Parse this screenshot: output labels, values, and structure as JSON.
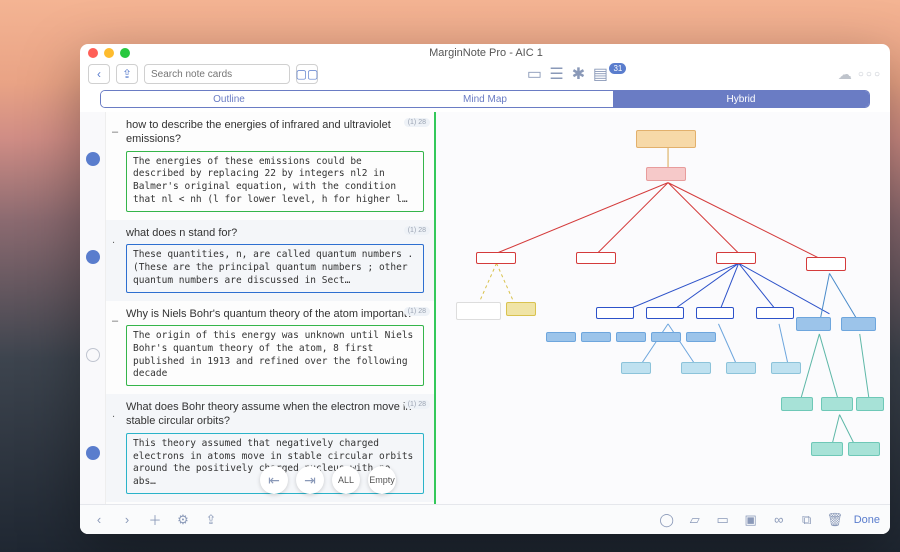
{
  "window_title": "MarginNote Pro - AIC 1",
  "toolbar": {
    "search_placeholder": "Search note cards",
    "badge_count": "31"
  },
  "tabs": [
    "Outline",
    "Mind Map",
    "Hybrid"
  ],
  "active_tab": "Hybrid",
  "cards": [
    {
      "collapse": "–",
      "question": "how to describe the energies of infrared and ultraviolet emissions?",
      "note": "The  energies of these emissions could be described by replacing   22   by integers   nl2   in Balmer's original equation, with the condition that   nl < nh   (l for lower level, h for higher l…",
      "note_style": "n-green",
      "page": "(1) 28"
    },
    {
      "collapse": ".",
      "question": "what does n stand for?",
      "note": "These quantities,   n,    are called quantum numbers . (These are the principal quantum  numbers ; other quantum numbers are discussed in  Sect…",
      "note_style": "n-blue",
      "page": "(1) 28"
    },
    {
      "collapse": "–",
      "question": "Why is Niels Bohr's quantum theory of the atom important?",
      "note": "The origin of this energy was unknown until Niels Bohr's quantum theory of the atom,   8    first published in 1913 and refined over the following decade",
      "note_style": "n-green",
      "page": "(1) 28"
    },
    {
      "collapse": ".",
      "question": "What does Bohr theory assume when the electron move in stable circular orbits?",
      "note": "This theory assumed that negatively charged electrons in atoms move in stable circular orbits around the positively charged nucleus with no abs…",
      "note_style": "n-cyan",
      "page": "(1) 28"
    }
  ],
  "float_buttons": {
    "all": "ALL",
    "empty": "Empty"
  },
  "done_label": "Done"
}
